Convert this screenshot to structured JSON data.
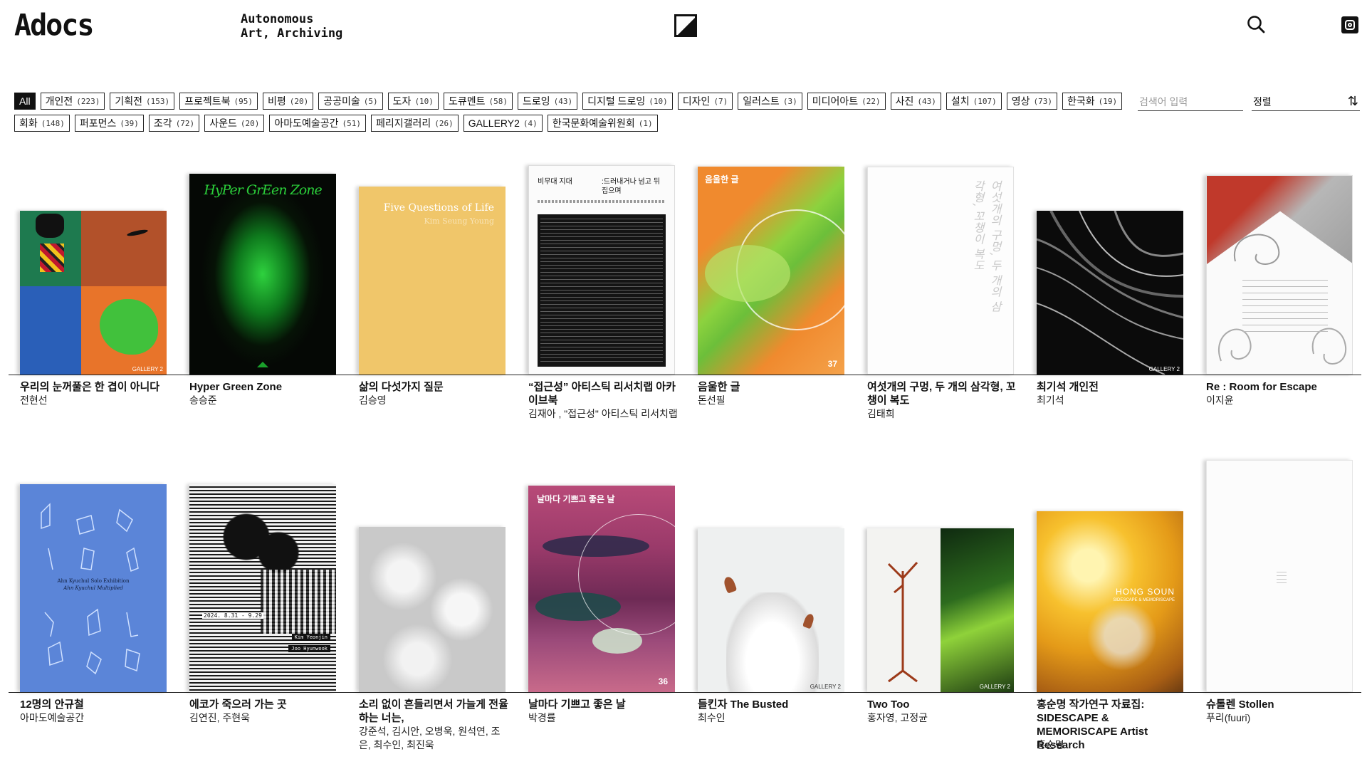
{
  "header": {
    "logo": "Adocs",
    "tagline_line1": "Autonomous",
    "tagline_line2": "Art, Archiving"
  },
  "filters": {
    "row1": [
      {
        "label": "All",
        "count": ""
      },
      {
        "label": "개인전",
        "count": "(223)"
      },
      {
        "label": "기획전",
        "count": "(153)"
      },
      {
        "label": "프로젝트북",
        "count": "(95)"
      },
      {
        "label": "비평",
        "count": "(20)"
      },
      {
        "label": "공공미술",
        "count": "(5)"
      },
      {
        "label": "도자",
        "count": "(10)"
      },
      {
        "label": "도큐멘트",
        "count": "(58)"
      },
      {
        "label": "드로잉",
        "count": "(43)"
      },
      {
        "label": "디지털 드로잉",
        "count": "(10)"
      },
      {
        "label": "디자인",
        "count": "(7)"
      },
      {
        "label": "일러스트",
        "count": "(3)"
      },
      {
        "label": "미디어아트",
        "count": "(22)"
      },
      {
        "label": "사진",
        "count": "(43)"
      },
      {
        "label": "설치",
        "count": "(107)"
      },
      {
        "label": "영상",
        "count": "(73)"
      },
      {
        "label": "한국화",
        "count": "(19)"
      }
    ],
    "row2": [
      {
        "label": "회화",
        "count": "(148)"
      },
      {
        "label": "퍼포먼스",
        "count": "(39)"
      },
      {
        "label": "조각",
        "count": "(72)"
      },
      {
        "label": "사운드",
        "count": "(20)"
      },
      {
        "label": "아마도예술공간",
        "count": "(51)"
      },
      {
        "label": "페리지갤러리",
        "count": "(26)"
      },
      {
        "label": "GALLERY2",
        "count": "(4)"
      },
      {
        "label": "한국문화예술위원회",
        "count": "(1)"
      }
    ],
    "search_placeholder": "검색어 입력",
    "sort_label": "정렬",
    "sort_icon": "⇅"
  },
  "books_row1": [
    {
      "title": "우리의 눈꺼풀은 한 겹이 아니다",
      "author": "전현선"
    },
    {
      "title": "Hyper Green Zone",
      "author": "송승준"
    },
    {
      "title": "삶의 다섯가지 질문",
      "author": "김승영"
    },
    {
      "title": "“접근성” 아티스틱 리서치랩 아카이브북",
      "author": "김재아 , \"접근성\" 아티스틱 리서치랩"
    },
    {
      "title": "음울한 글",
      "author": "돈선필"
    },
    {
      "title": "여섯개의 구멍, 두 개의 삼각형, 꼬챙이 복도",
      "author": "김태희"
    },
    {
      "title": "최기석 개인전",
      "author": "최기석"
    },
    {
      "title": "Re : Room for Escape",
      "author": "이지윤"
    }
  ],
  "books_row2": [
    {
      "title": "12명의 안규철",
      "author": "아마도예술공간"
    },
    {
      "title": "에코가 죽으러 가는 곳",
      "author": "김연진, 주현욱"
    },
    {
      "title": "소리 없이 흔들리면서 가늘게 전율하는 너는,",
      "author": "강준석, 김시안, 오병욱, 원석연, 조은, 최수인, 최진욱"
    },
    {
      "title": "날마다 기쁘고 좋은 날",
      "author": "박경률"
    },
    {
      "title": "들킨자 The Busted",
      "author": "최수인"
    },
    {
      "title": "Two Too",
      "author": "홍자영, 고정균"
    },
    {
      "title": "홍순명 작가연구 자료집: SIDESCAPE & MEMORISCAPE Artist Research",
      "author": "홍순명"
    },
    {
      "title": "슈톨렌 Stollen",
      "author": "푸리(fuuri)"
    }
  ],
  "covers": {
    "hyper_green_title": "HyPer GrEen Zone",
    "five_questions_title": "Five Questions of Life",
    "five_questions_author": "Kim Seung Young",
    "accessibility_head_left": "비무대 지대",
    "accessibility_head_right": ":드러내거나 넘고 뒤집으며",
    "gloomy_title": "음울한 글",
    "gloomy_number": "37",
    "six_holes_title": "여섯개의 구멍, 두 개의 삼각형, 꼬챙이 복도",
    "gallery2": "GALLERY 2",
    "re_room_title": "Re : Room for Escape",
    "ahn_title": "Ahn Kyuchul Solo Exhibition",
    "ahn_subtitle": "Ahn Kyuchul Multiplied",
    "echo_date": "2024. 8.31 - 9.29",
    "echo_artist1": "Kim Yeonjin",
    "echo_artist2": "Joo Hyunwook",
    "everyday_title": "날마다 기쁘고 좋은 날",
    "everyday_number": "36",
    "hong_title": "HONG SOUN",
    "hong_subtitle": "SIDESCAPE & MEMORISCAPE"
  },
  "colors": {
    "accent": "#111111",
    "green_cover": "#3aa24a",
    "yellow_cover": "#f0c66a",
    "orange_cover": "#f08a2e",
    "blue_cover": "#5b85d8"
  }
}
